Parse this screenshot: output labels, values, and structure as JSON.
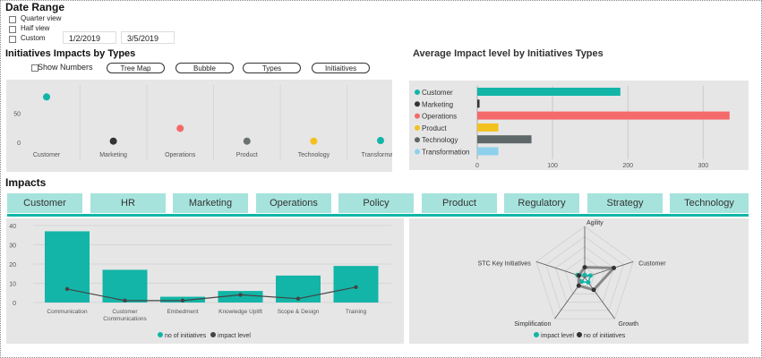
{
  "date_range": {
    "title": "Date Range",
    "options": [
      "Quarter view",
      "Half view",
      "Custom"
    ],
    "start_date": "1/2/2019",
    "end_date": "3/5/2019"
  },
  "impacts_by_types": {
    "title": "Initiatives Impacts by Types",
    "show_numbers_label": "Show Numbers",
    "buttons": [
      "Tree Map",
      "Bubble",
      "Types",
      "Initiaitives"
    ]
  },
  "avg_impact": {
    "title": "Average Impact level by Initiatives Types"
  },
  "impacts": {
    "title": "Impacts",
    "tabs": [
      "Customer",
      "HR",
      "Marketing",
      "Operations",
      "Policy",
      "Product",
      "Regulatory",
      "Strategy",
      "Technology"
    ]
  },
  "colors": {
    "accent": "#12b5a7",
    "tab": "#a6e3dc",
    "panel": "#e6e6e6"
  },
  "chart_data": [
    {
      "type": "scatter",
      "categories": [
        "Customer",
        "Marketing",
        "Operations",
        "Product",
        "Technology",
        "Transformatio"
      ],
      "values": [
        78,
        2,
        24,
        2,
        2,
        3
      ],
      "colors": [
        "#12b5a7",
        "#333333",
        "#f46a6a",
        "#6b7070",
        "#f2c11d",
        "#12b5a7"
      ],
      "y_ticks": [
        "50",
        "0"
      ],
      "ylim": [
        0,
        100
      ]
    },
    {
      "type": "bar",
      "orientation": "horizontal",
      "categories": [
        "Customer",
        "Marketing",
        "Operations",
        "Product",
        "Technology",
        "Transformation"
      ],
      "values": [
        190,
        3,
        335,
        28,
        72,
        28
      ],
      "colors": [
        "#12b5a7",
        "#333333",
        "#f46a6a",
        "#f2c11d",
        "#5f6868",
        "#8ed0ec"
      ],
      "x_ticks": [
        "0",
        "100",
        "200",
        "300"
      ],
      "xlim": [
        0,
        340
      ],
      "legend_position": "left"
    },
    {
      "type": "bar",
      "categories": [
        "Communication",
        "Customer Communications",
        "Embedment",
        "Knowledge Uplift",
        "Scope & Design",
        "Training"
      ],
      "series": [
        {
          "name": "no of initiatives",
          "values": [
            37,
            17,
            3,
            6,
            14,
            19
          ]
        },
        {
          "name": "impact level",
          "values": [
            7,
            1,
            1,
            4,
            2,
            8
          ]
        }
      ],
      "y_ticks": [
        "40",
        "30",
        "20",
        "10",
        "0"
      ],
      "ylim": [
        0,
        40
      ],
      "legend_position": "bottom"
    },
    {
      "type": "radar",
      "axes": [
        "Agility",
        "Customer",
        "Growth",
        "Simplification",
        "STC Key Initiatives"
      ],
      "series": [
        {
          "name": "impact level",
          "values": [
            0.05,
            0.12,
            0.12,
            0.1,
            0.15
          ]
        },
        {
          "name": "no of initiatives",
          "values": [
            0.2,
            0.6,
            0.3,
            0.2,
            0.12
          ]
        }
      ],
      "legend_position": "bottom"
    }
  ]
}
